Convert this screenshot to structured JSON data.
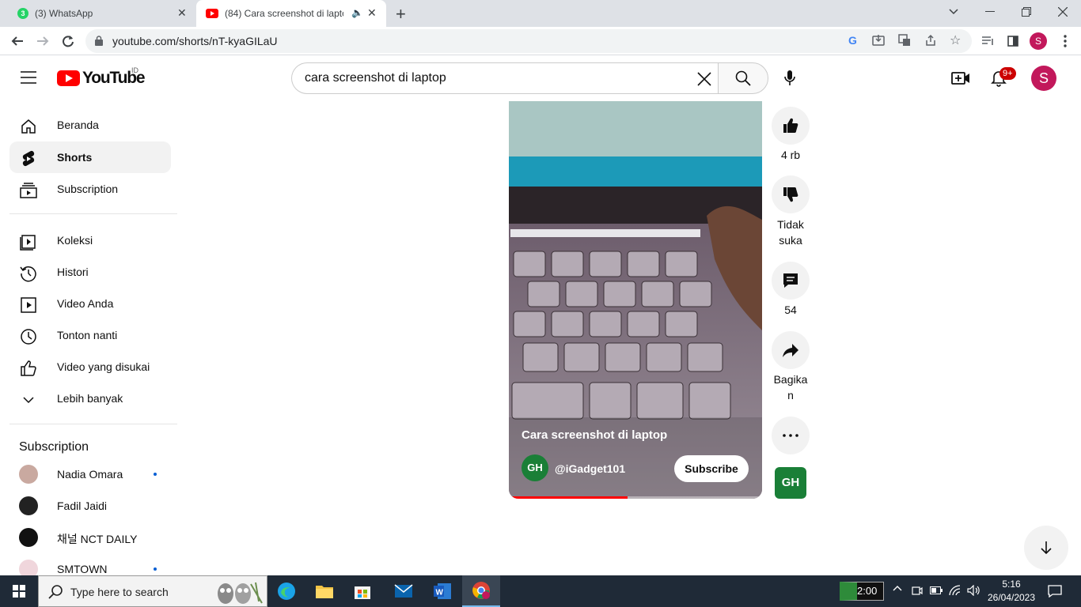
{
  "browser": {
    "tabs": [
      {
        "title": "(3) WhatsApp",
        "icon": "whatsapp-icon",
        "active": false
      },
      {
        "title": "(84) Cara screenshot di lapto",
        "icon": "youtube-icon",
        "active": true
      }
    ],
    "url": "youtube.com/shorts/nT-kyaGILaU",
    "profile_initial": "S"
  },
  "youtube": {
    "logo_text": "YouTube",
    "region": "ID",
    "search_query": "cara screenshot di laptop",
    "notifications_badge": "9+",
    "avatar_initial": "S"
  },
  "sidebar": {
    "main": [
      {
        "label": "Beranda",
        "icon": "home-icon"
      },
      {
        "label": "Shorts",
        "icon": "shorts-icon",
        "active": true
      },
      {
        "label": "Subscription",
        "icon": "subscriptions-icon"
      }
    ],
    "library": [
      {
        "label": "Koleksi",
        "icon": "library-icon"
      },
      {
        "label": "Histori",
        "icon": "history-icon"
      },
      {
        "label": "Video Anda",
        "icon": "your-videos-icon"
      },
      {
        "label": "Tonton nanti",
        "icon": "watch-later-icon"
      },
      {
        "label": "Video yang disukai",
        "icon": "liked-videos-icon"
      },
      {
        "label": "Lebih banyak",
        "icon": "chevron-down-icon"
      }
    ],
    "subscription_heading": "Subscription",
    "subscriptions": [
      {
        "name": "Nadia Omara",
        "new": true,
        "color": "#c9a9a0"
      },
      {
        "name": "Fadil Jaidi",
        "new": false,
        "color": "#222222"
      },
      {
        "name": "채널 NCT DAILY",
        "new": false,
        "color": "#111111"
      },
      {
        "name": "SMTOWN",
        "new": true,
        "color": "#f0d6dc"
      }
    ]
  },
  "short": {
    "title": "Cara screenshot di laptop",
    "channel": "@iGadget101",
    "channel_avatar_text": "GH",
    "subscribe_label": "Subscribe",
    "progress": 0.47
  },
  "actions": {
    "like_count": "4 rb",
    "dislike_label_1": "Tidak",
    "dislike_label_2": "suka",
    "comment_count": "54",
    "share_label_1": "Bagika",
    "share_label_2": "n"
  },
  "taskbar": {
    "search_placeholder": "Type here to search",
    "battery_timer": "2:00",
    "time": "5:16",
    "date": "26/04/2023"
  },
  "colors": {
    "youtube_red": "#ff0000",
    "channel_green": "#1a7f37",
    "avatar_purple": "#c2185b"
  }
}
